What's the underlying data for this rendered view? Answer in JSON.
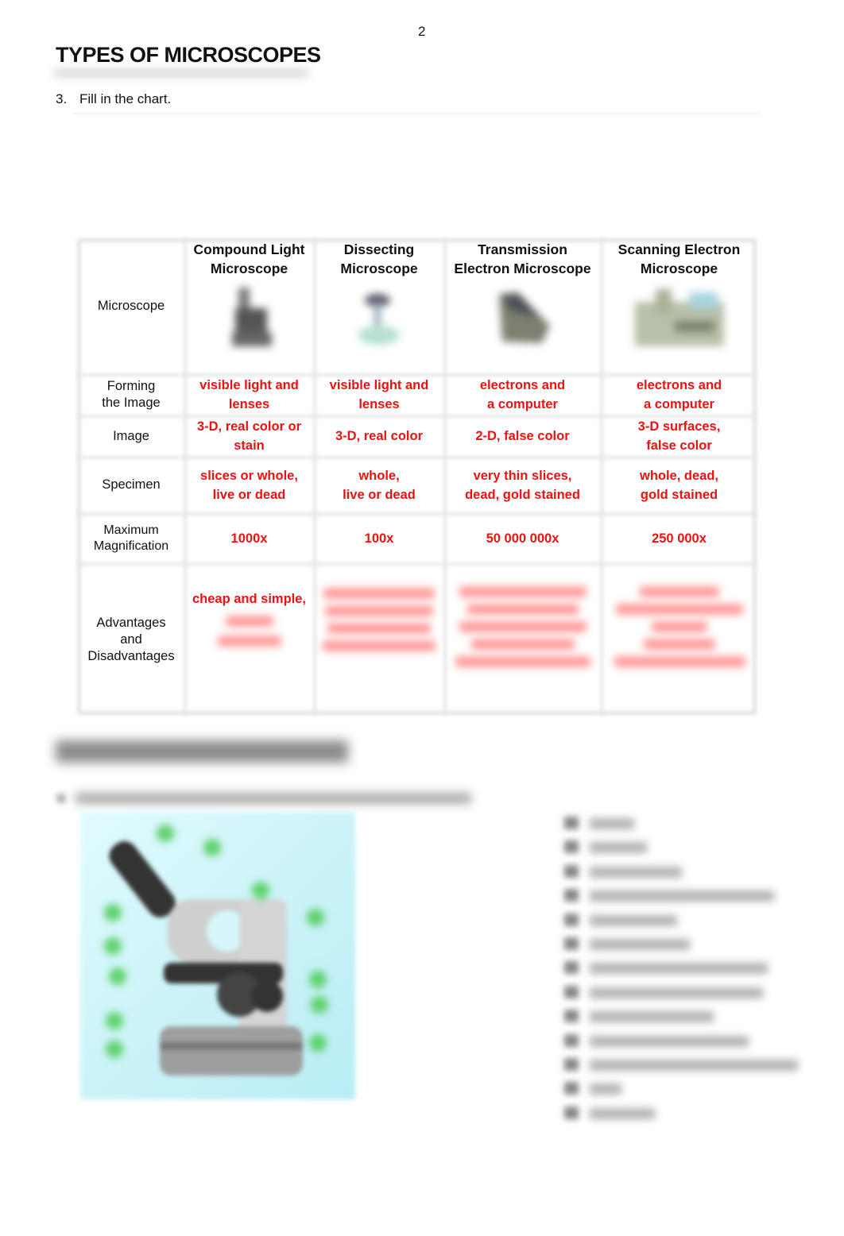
{
  "page": {
    "number": "2",
    "title": "TYPES OF MICROSCOPES",
    "question": {
      "number": "3.",
      "text": "Fill in the chart."
    }
  },
  "table": {
    "row_labels": {
      "microscope": "Microscope",
      "forming": [
        "Forming",
        "the Image"
      ],
      "image": "Image",
      "specimen": "Specimen",
      "magnification": [
        "Maximum",
        "Magnification"
      ],
      "advantages": [
        "Advantages",
        "and",
        "Disadvantages"
      ]
    },
    "columns": [
      {
        "header": [
          "Compound Light",
          "Microscope"
        ],
        "image_icon": "compound-light-microscope-photo",
        "forming": [
          "visible light and",
          "lenses"
        ],
        "image": [
          "3-D, real color or",
          "stain"
        ],
        "specimen": [
          "slices or whole,",
          "live or dead"
        ],
        "magnification": "1000x",
        "advantages_visible": "cheap and simple,"
      },
      {
        "header": [
          "Dissecting",
          "Microscope"
        ],
        "image_icon": "dissecting-microscope-photo",
        "forming": [
          "visible light and",
          "lenses"
        ],
        "image": [
          "3-D, real color"
        ],
        "specimen": [
          "whole,",
          "live or dead"
        ],
        "magnification": "100x",
        "advantages_visible": ""
      },
      {
        "header": [
          "Transmission",
          "Electron Microscope"
        ],
        "image_icon": "transmission-electron-microscope-photo",
        "forming": [
          "electrons and",
          "a computer"
        ],
        "image": [
          "2-D, false color"
        ],
        "specimen": [
          "very thin slices,",
          "dead, gold stained"
        ],
        "magnification": "50 000 000x",
        "advantages_visible": ""
      },
      {
        "header": [
          "Scanning Electron",
          "Microscope"
        ],
        "image_icon": "scanning-electron-microscope-photo",
        "forming": [
          "electrons and",
          "a computer"
        ],
        "image": [
          "3-D surfaces,",
          "false color"
        ],
        "specimen": [
          "whole, dead,",
          "gold stained"
        ],
        "magnification": "250 000x",
        "advantages_visible": ""
      }
    ],
    "answer_color": "#ee1111"
  },
  "section2": {
    "heading": "",
    "instruction": "",
    "diagram_icon": "labeled-microscope-diagram",
    "parts_list_count": 14
  }
}
